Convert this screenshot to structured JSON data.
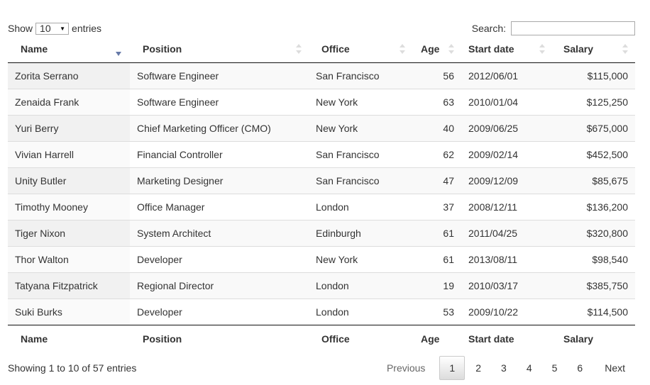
{
  "length_control": {
    "show_label": "Show",
    "entries_label": "entries",
    "selected": "10"
  },
  "search": {
    "label": "Search:",
    "value": ""
  },
  "columns": [
    "Name",
    "Position",
    "Office",
    "Age",
    "Start date",
    "Salary"
  ],
  "rows": [
    [
      "Zorita Serrano",
      "Software Engineer",
      "San Francisco",
      "56",
      "2012/06/01",
      "$115,000"
    ],
    [
      "Zenaida Frank",
      "Software Engineer",
      "New York",
      "63",
      "2010/01/04",
      "$125,250"
    ],
    [
      "Yuri Berry",
      "Chief Marketing Officer (CMO)",
      "New York",
      "40",
      "2009/06/25",
      "$675,000"
    ],
    [
      "Vivian Harrell",
      "Financial Controller",
      "San Francisco",
      "62",
      "2009/02/14",
      "$452,500"
    ],
    [
      "Unity Butler",
      "Marketing Designer",
      "San Francisco",
      "47",
      "2009/12/09",
      "$85,675"
    ],
    [
      "Timothy Mooney",
      "Office Manager",
      "London",
      "37",
      "2008/12/11",
      "$136,200"
    ],
    [
      "Tiger Nixon",
      "System Architect",
      "Edinburgh",
      "61",
      "2011/04/25",
      "$320,800"
    ],
    [
      "Thor Walton",
      "Developer",
      "New York",
      "61",
      "2013/08/11",
      "$98,540"
    ],
    [
      "Tatyana Fitzpatrick",
      "Regional Director",
      "London",
      "19",
      "2010/03/17",
      "$385,750"
    ],
    [
      "Suki Burks",
      "Developer",
      "London",
      "53",
      "2009/10/22",
      "$114,500"
    ]
  ],
  "footer": {
    "info": "Showing 1 to 10 of 57 entries"
  },
  "pagination": {
    "previous": "Previous",
    "pages": [
      "1",
      "2",
      "3",
      "4",
      "5",
      "6"
    ],
    "current": "1",
    "next": "Next"
  },
  "colors": {
    "sort_active": "#6679a8",
    "sort_inactive": "#dddddd",
    "row_odd": "#f9f9f9",
    "sorted_col_odd": "#f1f1f1"
  }
}
